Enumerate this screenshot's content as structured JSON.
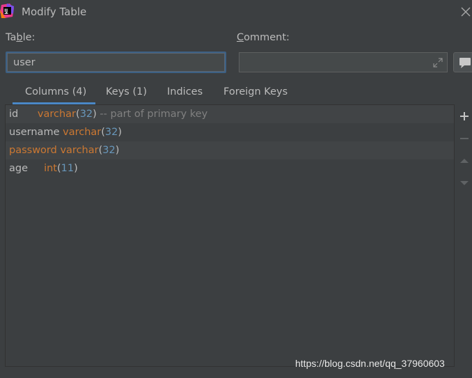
{
  "window": {
    "title": "Modify Table"
  },
  "form": {
    "table_label_pre": "Ta",
    "table_label_mnemonic": "b",
    "table_label_post": "le:",
    "table_value": "user",
    "comment_label_mnemonic": "C",
    "comment_label_post": "omment:",
    "comment_value": ""
  },
  "tabs": [
    {
      "label": "Columns (4)",
      "active": true
    },
    {
      "label": "Keys (1)"
    },
    {
      "label": "Indices"
    },
    {
      "label": "Foreign Keys"
    }
  ],
  "columns": [
    {
      "name": "id",
      "sep": "      ",
      "type": "varchar",
      "size": "32",
      "comment": " -- part of primary key"
    },
    {
      "name": "username",
      "sep": " ",
      "type": "varchar",
      "size": "32",
      "comment": ""
    },
    {
      "name": "password",
      "sep": " ",
      "type": "varchar",
      "size": "32",
      "comment": ""
    },
    {
      "name": "age",
      "sep": "     ",
      "type": "int",
      "size": "11",
      "comment": ""
    }
  ],
  "toolbar": [
    "add-icon",
    "remove-icon",
    "move-up-icon",
    "move-down-icon"
  ],
  "watermark": "https://blog.csdn.net/qq_37960603",
  "colors": {
    "accent": "#4a88c7",
    "type": "#cc7832",
    "number": "#6897bb",
    "comment": "#808080"
  }
}
